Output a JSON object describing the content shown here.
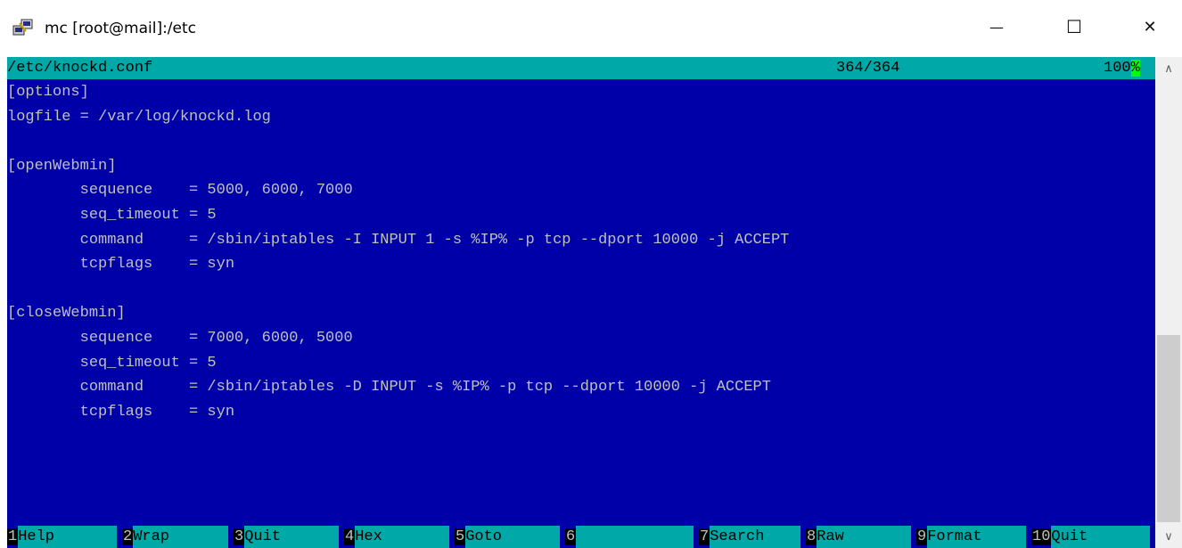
{
  "window": {
    "title": "mc [root@mail]:/etc",
    "icon": "putty-icon",
    "minimize_glyph": "—",
    "maximize_glyph": "☐",
    "close_glyph": "✕"
  },
  "viewer": {
    "file_path": "/etc/knockd.conf",
    "position": "364/364",
    "percent_main": "100",
    "percent_last": "%",
    "lines": [
      "[options]",
      "logfile = /var/log/knockd.log",
      "",
      "[openWebmin]",
      "        sequence    = 5000, 6000, 7000",
      "        seq_timeout = 5",
      "        command     = /sbin/iptables -I INPUT 1 -s %IP% -p tcp --dport 10000 -j ACCEPT",
      "        tcpflags    = syn",
      "",
      "[closeWebmin]",
      "        sequence    = 7000, 6000, 5000",
      "        seq_timeout = 5",
      "        command     = /sbin/iptables -D INPUT -s %IP% -p tcp --dport 10000 -j ACCEPT",
      "        tcpflags    = syn"
    ]
  },
  "fkeys": [
    {
      "num": "1",
      "label": "Help  "
    },
    {
      "num": "2",
      "label": "Wrap  "
    },
    {
      "num": "3",
      "label": "Quit  "
    },
    {
      "num": "4",
      "label": "Hex   "
    },
    {
      "num": "5",
      "label": "Goto  "
    },
    {
      "num": "6",
      "label": "      "
    },
    {
      "num": "7",
      "label": "Search"
    },
    {
      "num": "8",
      "label": "Raw   "
    },
    {
      "num": "9",
      "label": "Format"
    },
    {
      "num": "10",
      "label": "Quit  "
    }
  ],
  "scrollbar": {
    "up_glyph": "∧",
    "down_glyph": "∨"
  },
  "colors": {
    "terminal_bg": "#0000a8",
    "status_bg": "#00a8a8",
    "text": "#c0c0c0",
    "highlight": "#00ff00"
  }
}
